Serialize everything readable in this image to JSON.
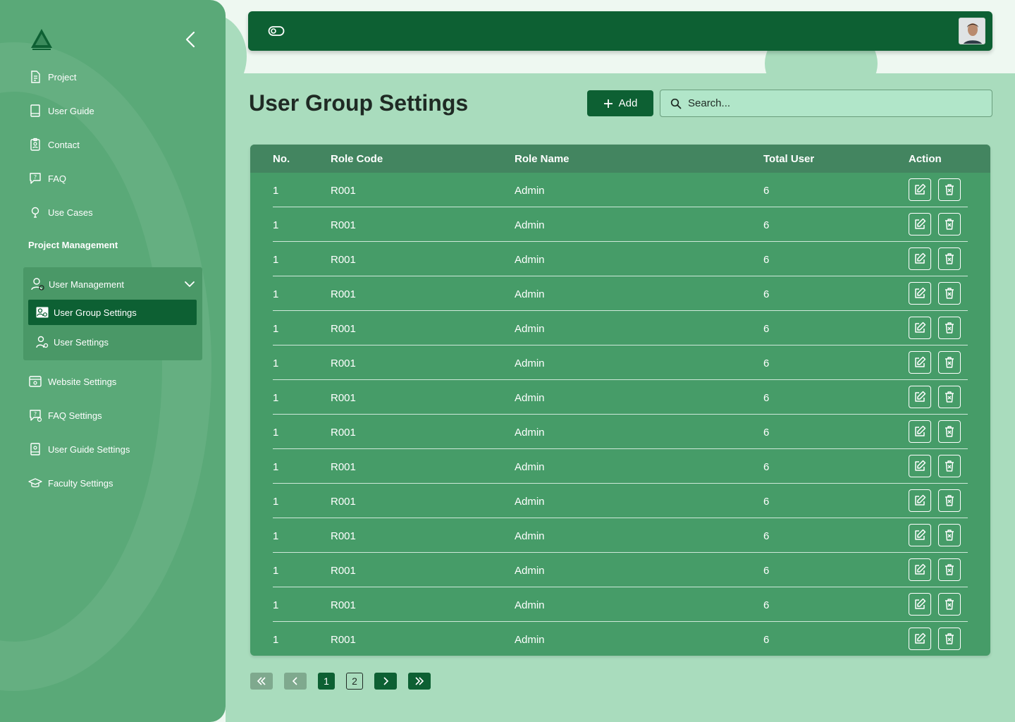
{
  "sidebar": {
    "nav": [
      {
        "label": "Project",
        "icon": "document-icon"
      },
      {
        "label": "User Guide",
        "icon": "book-icon"
      },
      {
        "label": "Contact",
        "icon": "contact-badge-icon"
      },
      {
        "label": "FAQ",
        "icon": "chat-question-icon"
      },
      {
        "label": "Use Cases",
        "icon": "lightbulb-icon"
      }
    ],
    "section_title": "Project Management",
    "user_management": {
      "label": "User Management",
      "children": [
        {
          "label": "User Group Settings",
          "active": true
        },
        {
          "label": "User Settings",
          "active": false
        }
      ]
    },
    "settings_nav": [
      {
        "label": "Website Settings",
        "icon": "website-settings-icon"
      },
      {
        "label": "FAQ Settings",
        "icon": "faq-settings-icon"
      },
      {
        "label": "User Guide Settings",
        "icon": "guide-settings-icon"
      },
      {
        "label": "Faculty Settings",
        "icon": "graduation-cap-icon"
      }
    ]
  },
  "page": {
    "title": "User Group Settings",
    "add_label": "Add",
    "search_placeholder": "Search..."
  },
  "table": {
    "columns": [
      "No.",
      "Role Code",
      "Role Name",
      "Total User",
      "Action"
    ],
    "rows": [
      {
        "no": "1",
        "code": "R001",
        "name": "Admin",
        "total": "6"
      },
      {
        "no": "1",
        "code": "R001",
        "name": "Admin",
        "total": "6"
      },
      {
        "no": "1",
        "code": "R001",
        "name": "Admin",
        "total": "6"
      },
      {
        "no": "1",
        "code": "R001",
        "name": "Admin",
        "total": "6"
      },
      {
        "no": "1",
        "code": "R001",
        "name": "Admin",
        "total": "6"
      },
      {
        "no": "1",
        "code": "R001",
        "name": "Admin",
        "total": "6"
      },
      {
        "no": "1",
        "code": "R001",
        "name": "Admin",
        "total": "6"
      },
      {
        "no": "1",
        "code": "R001",
        "name": "Admin",
        "total": "6"
      },
      {
        "no": "1",
        "code": "R001",
        "name": "Admin",
        "total": "6"
      },
      {
        "no": "1",
        "code": "R001",
        "name": "Admin",
        "total": "6"
      },
      {
        "no": "1",
        "code": "R001",
        "name": "Admin",
        "total": "6"
      },
      {
        "no": "1",
        "code": "R001",
        "name": "Admin",
        "total": "6"
      },
      {
        "no": "1",
        "code": "R001",
        "name": "Admin",
        "total": "6"
      },
      {
        "no": "1",
        "code": "R001",
        "name": "Admin",
        "total": "6"
      }
    ]
  },
  "pagination": {
    "pages": [
      "1",
      "2"
    ],
    "current": "1"
  },
  "colors": {
    "primary": "#0d6033",
    "sidebar": "#5aa978",
    "main_bg": "#a9dcbd",
    "table_bg": "#469c68",
    "table_header": "#438560"
  }
}
